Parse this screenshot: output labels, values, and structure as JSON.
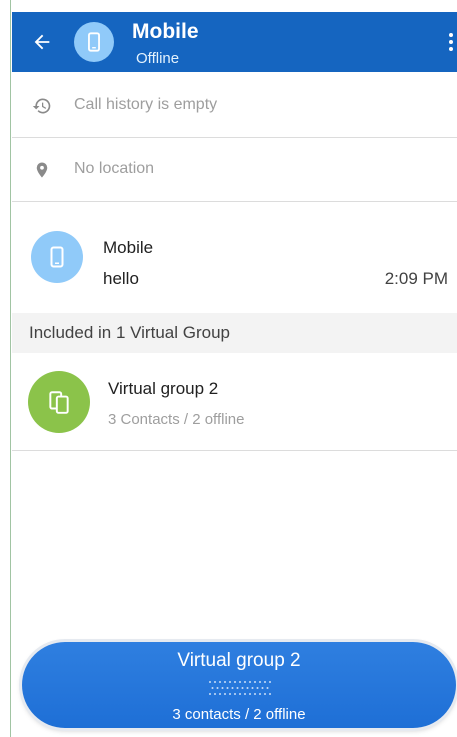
{
  "header": {
    "title": "Mobile",
    "subtitle": "Offline",
    "back_icon": "arrow-left-icon",
    "avatar_icon": "phone-icon",
    "menu_icon": "more-vert-icon",
    "color": "#1565c0"
  },
  "info_rows": [
    {
      "icon": "history-icon",
      "text": "Call history is empty"
    },
    {
      "icon": "location-pin-icon",
      "text": "No location"
    }
  ],
  "message": {
    "name": "Mobile",
    "text": "hello",
    "time": "2:09 PM",
    "avatar_color": "#90caf9"
  },
  "groups_section": {
    "title": "Included in 1 Virtual Group",
    "items": [
      {
        "name": "Virtual group 2",
        "subtitle": "3 Contacts / 2 offline",
        "avatar_color": "#8bc34a",
        "icon": "devices-icon"
      }
    ]
  },
  "ptt_button": {
    "title": "Virtual group 2",
    "subtitle": "3 contacts / 2 offline",
    "color": "#1e6fd6"
  }
}
